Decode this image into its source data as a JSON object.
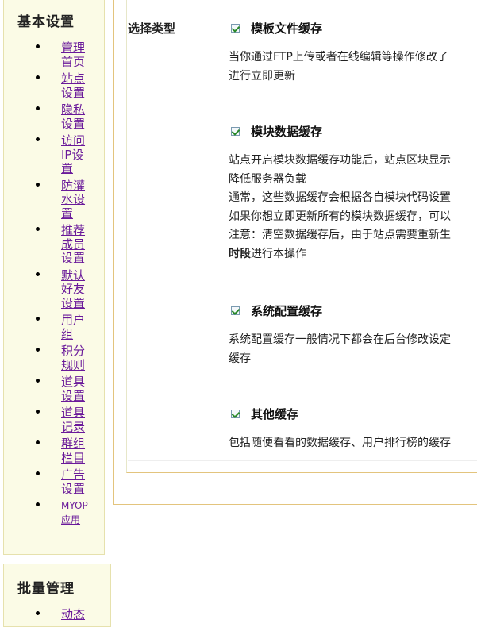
{
  "sidebar": {
    "section1_title": "基本设置",
    "items": [
      {
        "label": "管理首页"
      },
      {
        "label": "站点设置"
      },
      {
        "label": "隐私设置"
      },
      {
        "label": "访问IP设置"
      },
      {
        "label": "防灌水设置"
      },
      {
        "label": "推荐成员设置"
      },
      {
        "label": "默认好友设置"
      },
      {
        "label": "用户组"
      },
      {
        "label": "积分规则"
      },
      {
        "label": "道具设置"
      },
      {
        "label": "道具记录"
      },
      {
        "label": "群组栏目"
      },
      {
        "label": "广告设置"
      },
      {
        "label": "MYOP应用"
      }
    ],
    "section2_title": "批量管理",
    "section2_partial": "动态"
  },
  "main": {
    "type_label": "选择类型",
    "options": [
      {
        "title": "模板文件缓存",
        "checked": true,
        "desc": [
          "当你通过FTP上传或者在线编辑等操作修改了",
          "进行立即更新"
        ]
      },
      {
        "title": "模块数据缓存",
        "checked": true,
        "desc": [
          "站点开启模块数据缓存功能后，站点区块显示",
          "降低服务器负载",
          "通常，这些数据缓存会根据各自模块代码设置",
          "如果你想立即更新所有的模块数据缓存，可以",
          "注意：清空数据缓存后，由于站点需要重新生"
        ],
        "desc_bold": "时段",
        "desc_tail": "进行本操作"
      },
      {
        "title": "系统配置缓存",
        "checked": true,
        "desc": [
          "系统配置缓存一般情况下都会在后台修改设定",
          "缓存"
        ]
      },
      {
        "title": "其他缓存",
        "checked": true,
        "desc": [
          "包括随便看看的数据缓存、用户排行榜的缓存"
        ]
      }
    ]
  }
}
